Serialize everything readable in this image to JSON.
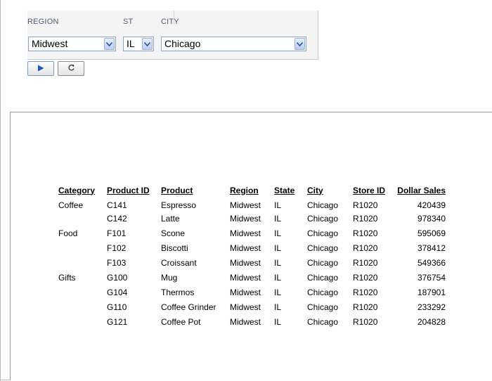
{
  "filters": {
    "region": {
      "label": "REGION",
      "value": "Midwest"
    },
    "state": {
      "label": "ST",
      "value": "IL"
    },
    "city": {
      "label": "CITY",
      "value": "Chicago"
    }
  },
  "buttons": {
    "run_icon": "play-icon",
    "reset_icon": "refresh-icon"
  },
  "report": {
    "columns": [
      "Category",
      "Product ID",
      "Product",
      "Region",
      "State",
      "City",
      "Store ID",
      "Dollar Sales"
    ],
    "rows": [
      {
        "category": "Coffee",
        "product_id": "C141",
        "product": "Espresso",
        "region": "Midwest",
        "state": "IL",
        "city": "Chicago",
        "store_id": "R1020",
        "dollar_sales": "420439"
      },
      {
        "category": "",
        "product_id": "C142",
        "product": "Latte",
        "region": "Midwest",
        "state": "IL",
        "city": "Chicago",
        "store_id": "R1020",
        "dollar_sales": "978340"
      },
      {
        "category": "Food",
        "product_id": "F101",
        "product": "Scone",
        "region": "Midwest",
        "state": "IL",
        "city": "Chicago",
        "store_id": "R1020",
        "dollar_sales": "595069"
      },
      {
        "category": "",
        "product_id": "F102",
        "product": "Biscotti",
        "region": "Midwest",
        "state": "IL",
        "city": "Chicago",
        "store_id": "R1020",
        "dollar_sales": "378412"
      },
      {
        "category": "",
        "product_id": "F103",
        "product": "Croissant",
        "region": "Midwest",
        "state": "IL",
        "city": "Chicago",
        "store_id": "R1020",
        "dollar_sales": "549366"
      },
      {
        "category": "Gifts",
        "product_id": "G100",
        "product": "Mug",
        "region": "Midwest",
        "state": "IL",
        "city": "Chicago",
        "store_id": "R1020",
        "dollar_sales": "376754"
      },
      {
        "category": "",
        "product_id": "G104",
        "product": "Thermos",
        "region": "Midwest",
        "state": "IL",
        "city": "Chicago",
        "store_id": "R1020",
        "dollar_sales": "187901"
      },
      {
        "category": "",
        "product_id": "G110",
        "product": "Coffee Grinder",
        "region": "Midwest",
        "state": "IL",
        "city": "Chicago",
        "store_id": "R1020",
        "dollar_sales": "233292"
      },
      {
        "category": "",
        "product_id": "G121",
        "product": "Coffee Pot",
        "region": "Midwest",
        "state": "IL",
        "city": "Chicago",
        "store_id": "R1020",
        "dollar_sales": "204828"
      }
    ]
  }
}
